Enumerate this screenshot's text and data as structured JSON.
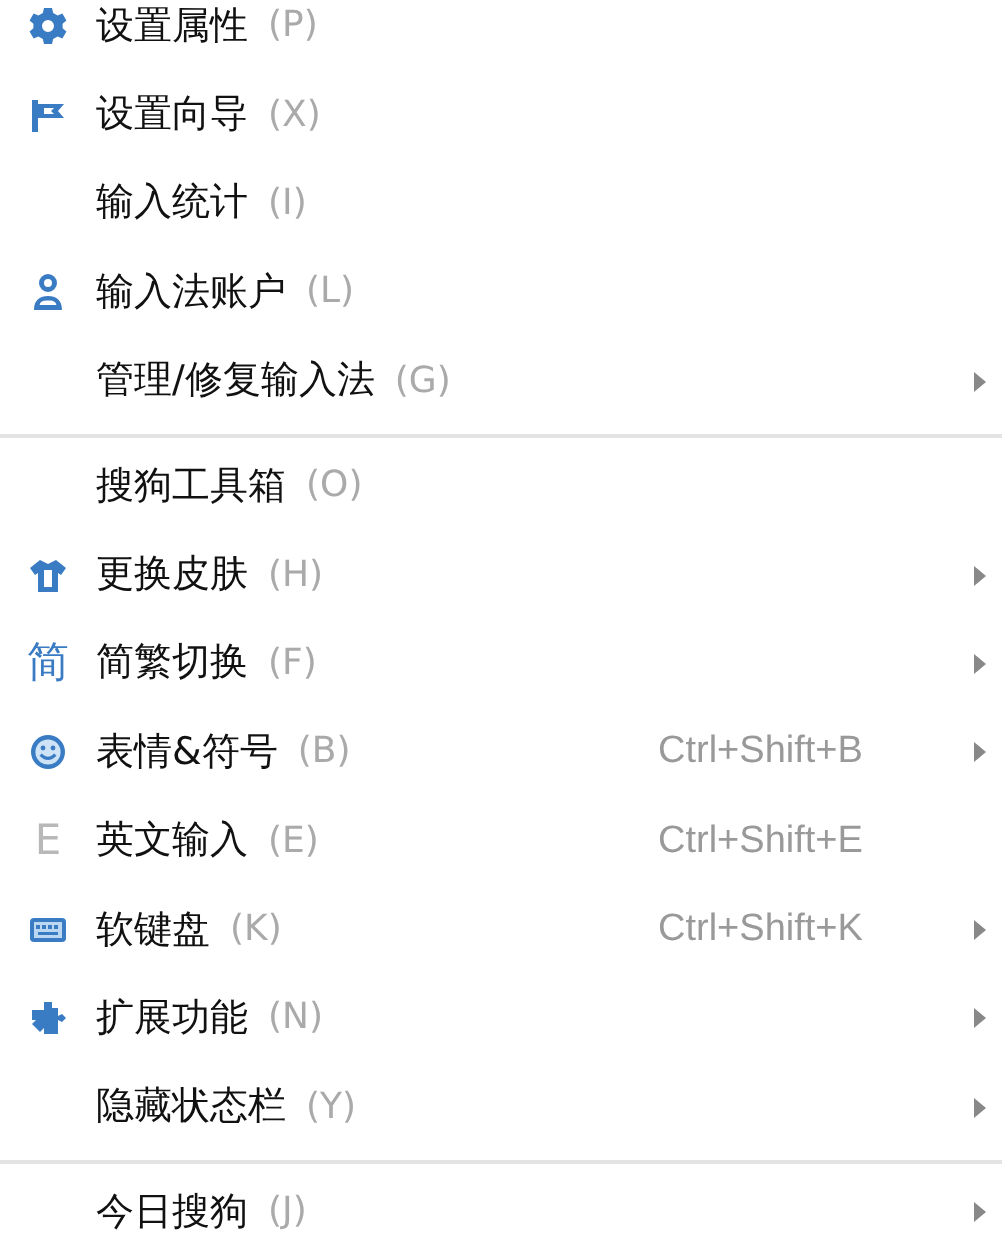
{
  "sections": [
    {
      "items": [
        {
          "kind": "gear",
          "label": "设置属性",
          "key": "(P)",
          "submenu": false
        },
        {
          "kind": "flag",
          "label": "设置向导",
          "key": "(X)",
          "submenu": false
        },
        {
          "kind": "plain",
          "label": "输入统计",
          "key": "(I)",
          "submenu": false
        },
        {
          "kind": "person",
          "label": "输入法账户",
          "key": "(L)",
          "submenu": false
        },
        {
          "kind": "plain",
          "label": "管理/修复输入法",
          "key": "(G)",
          "submenu": true
        }
      ]
    },
    {
      "items": [
        {
          "kind": "plain",
          "label": "搜狗工具箱",
          "key": "(O)",
          "submenu": false
        },
        {
          "kind": "shirt",
          "label": "更换皮肤",
          "key": "(H)",
          "submenu": true
        },
        {
          "kind": "glyph",
          "glyph": "简",
          "label": "简繁切换",
          "key": "(F)",
          "submenu": true
        },
        {
          "kind": "smiley",
          "label": "表情&符号",
          "key": "(B)",
          "shortcut": "Ctrl+Shift+B",
          "submenu": true
        },
        {
          "kind": "letter",
          "glyph": "E",
          "label": "英文输入",
          "key": "(E)",
          "shortcut": "Ctrl+Shift+E",
          "submenu": false
        },
        {
          "kind": "keyboard",
          "label": "软键盘",
          "key": "(K)",
          "shortcut": "Ctrl+Shift+K",
          "submenu": true
        },
        {
          "kind": "puzzle",
          "label": "扩展功能",
          "key": "(N)",
          "submenu": true
        },
        {
          "kind": "plain",
          "label": "隐藏状态栏",
          "key": "(Y)",
          "submenu": true
        }
      ]
    },
    {
      "items": [
        {
          "kind": "plain",
          "label": "今日搜狗",
          "key": "(J)",
          "submenu": true
        }
      ]
    }
  ]
}
